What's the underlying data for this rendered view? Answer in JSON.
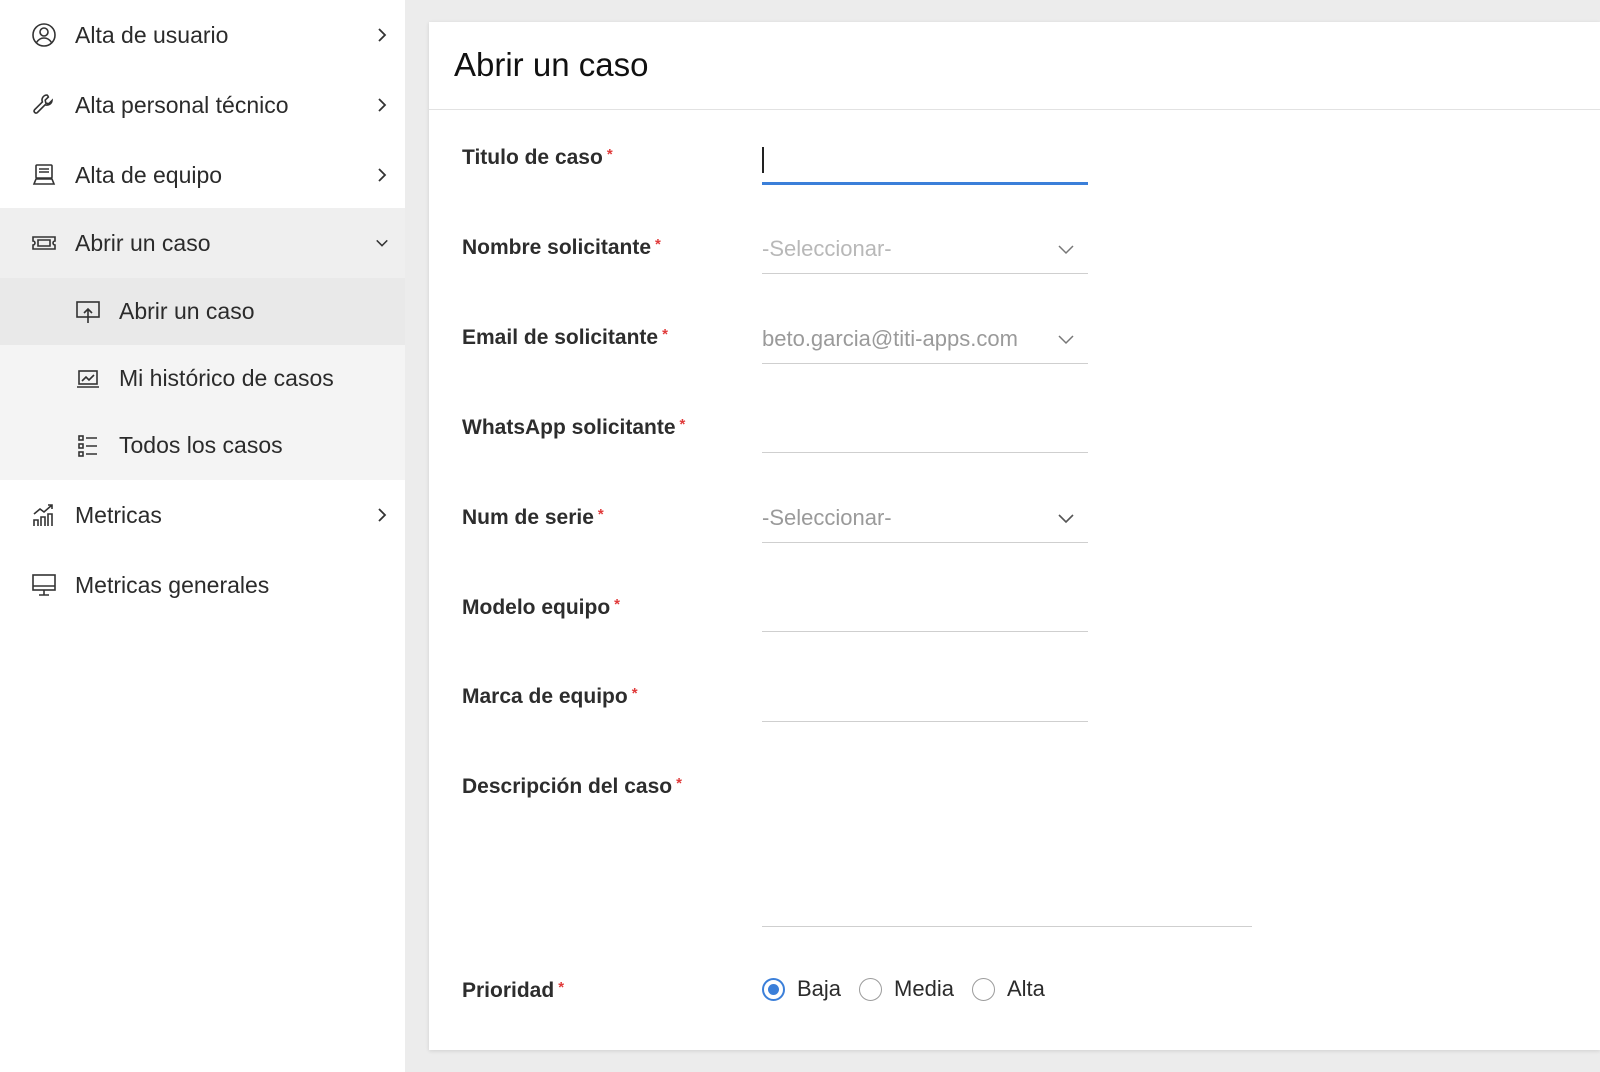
{
  "sidebar": {
    "items": [
      {
        "label": "Alta de usuario",
        "icon": "user-circle-icon"
      },
      {
        "label": "Alta personal técnico",
        "icon": "wrench-icon"
      },
      {
        "label": "Alta de equipo",
        "icon": "laptop-icon"
      },
      {
        "label": "Abrir un caso",
        "icon": "ticket-icon"
      },
      {
        "label": "Metricas",
        "icon": "bar-chart-icon"
      },
      {
        "label": "Metricas generales",
        "icon": "monitor-icon"
      }
    ],
    "submenu": [
      {
        "label": "Abrir un caso",
        "icon": "upload-screen-icon",
        "active": true
      },
      {
        "label": "Mi histórico de casos",
        "icon": "history-chart-icon"
      },
      {
        "label": "Todos los casos",
        "icon": "list-icon"
      }
    ]
  },
  "form": {
    "title": "Abrir un caso",
    "required_mark": "*",
    "fields": [
      {
        "label": "Titulo de caso",
        "value": ""
      },
      {
        "label": "Nombre solicitante",
        "value": "-Seleccionar-"
      },
      {
        "label": "Email de solicitante",
        "value": "beto.garcia@titi-apps.com"
      },
      {
        "label": "WhatsApp solicitante",
        "value": ""
      },
      {
        "label": "Num de serie",
        "value": "-Seleccionar-"
      },
      {
        "label": "Modelo equipo",
        "value": ""
      },
      {
        "label": "Marca de equipo",
        "value": ""
      },
      {
        "label": "Descripción del caso",
        "value": ""
      },
      {
        "label": "Prioridad"
      }
    ],
    "priority_options": [
      "Baja",
      "Media",
      "Alta"
    ],
    "priority_selected": "Baja"
  },
  "colors": {
    "accent": "#3b7fd9",
    "required": "#e03a3a"
  }
}
